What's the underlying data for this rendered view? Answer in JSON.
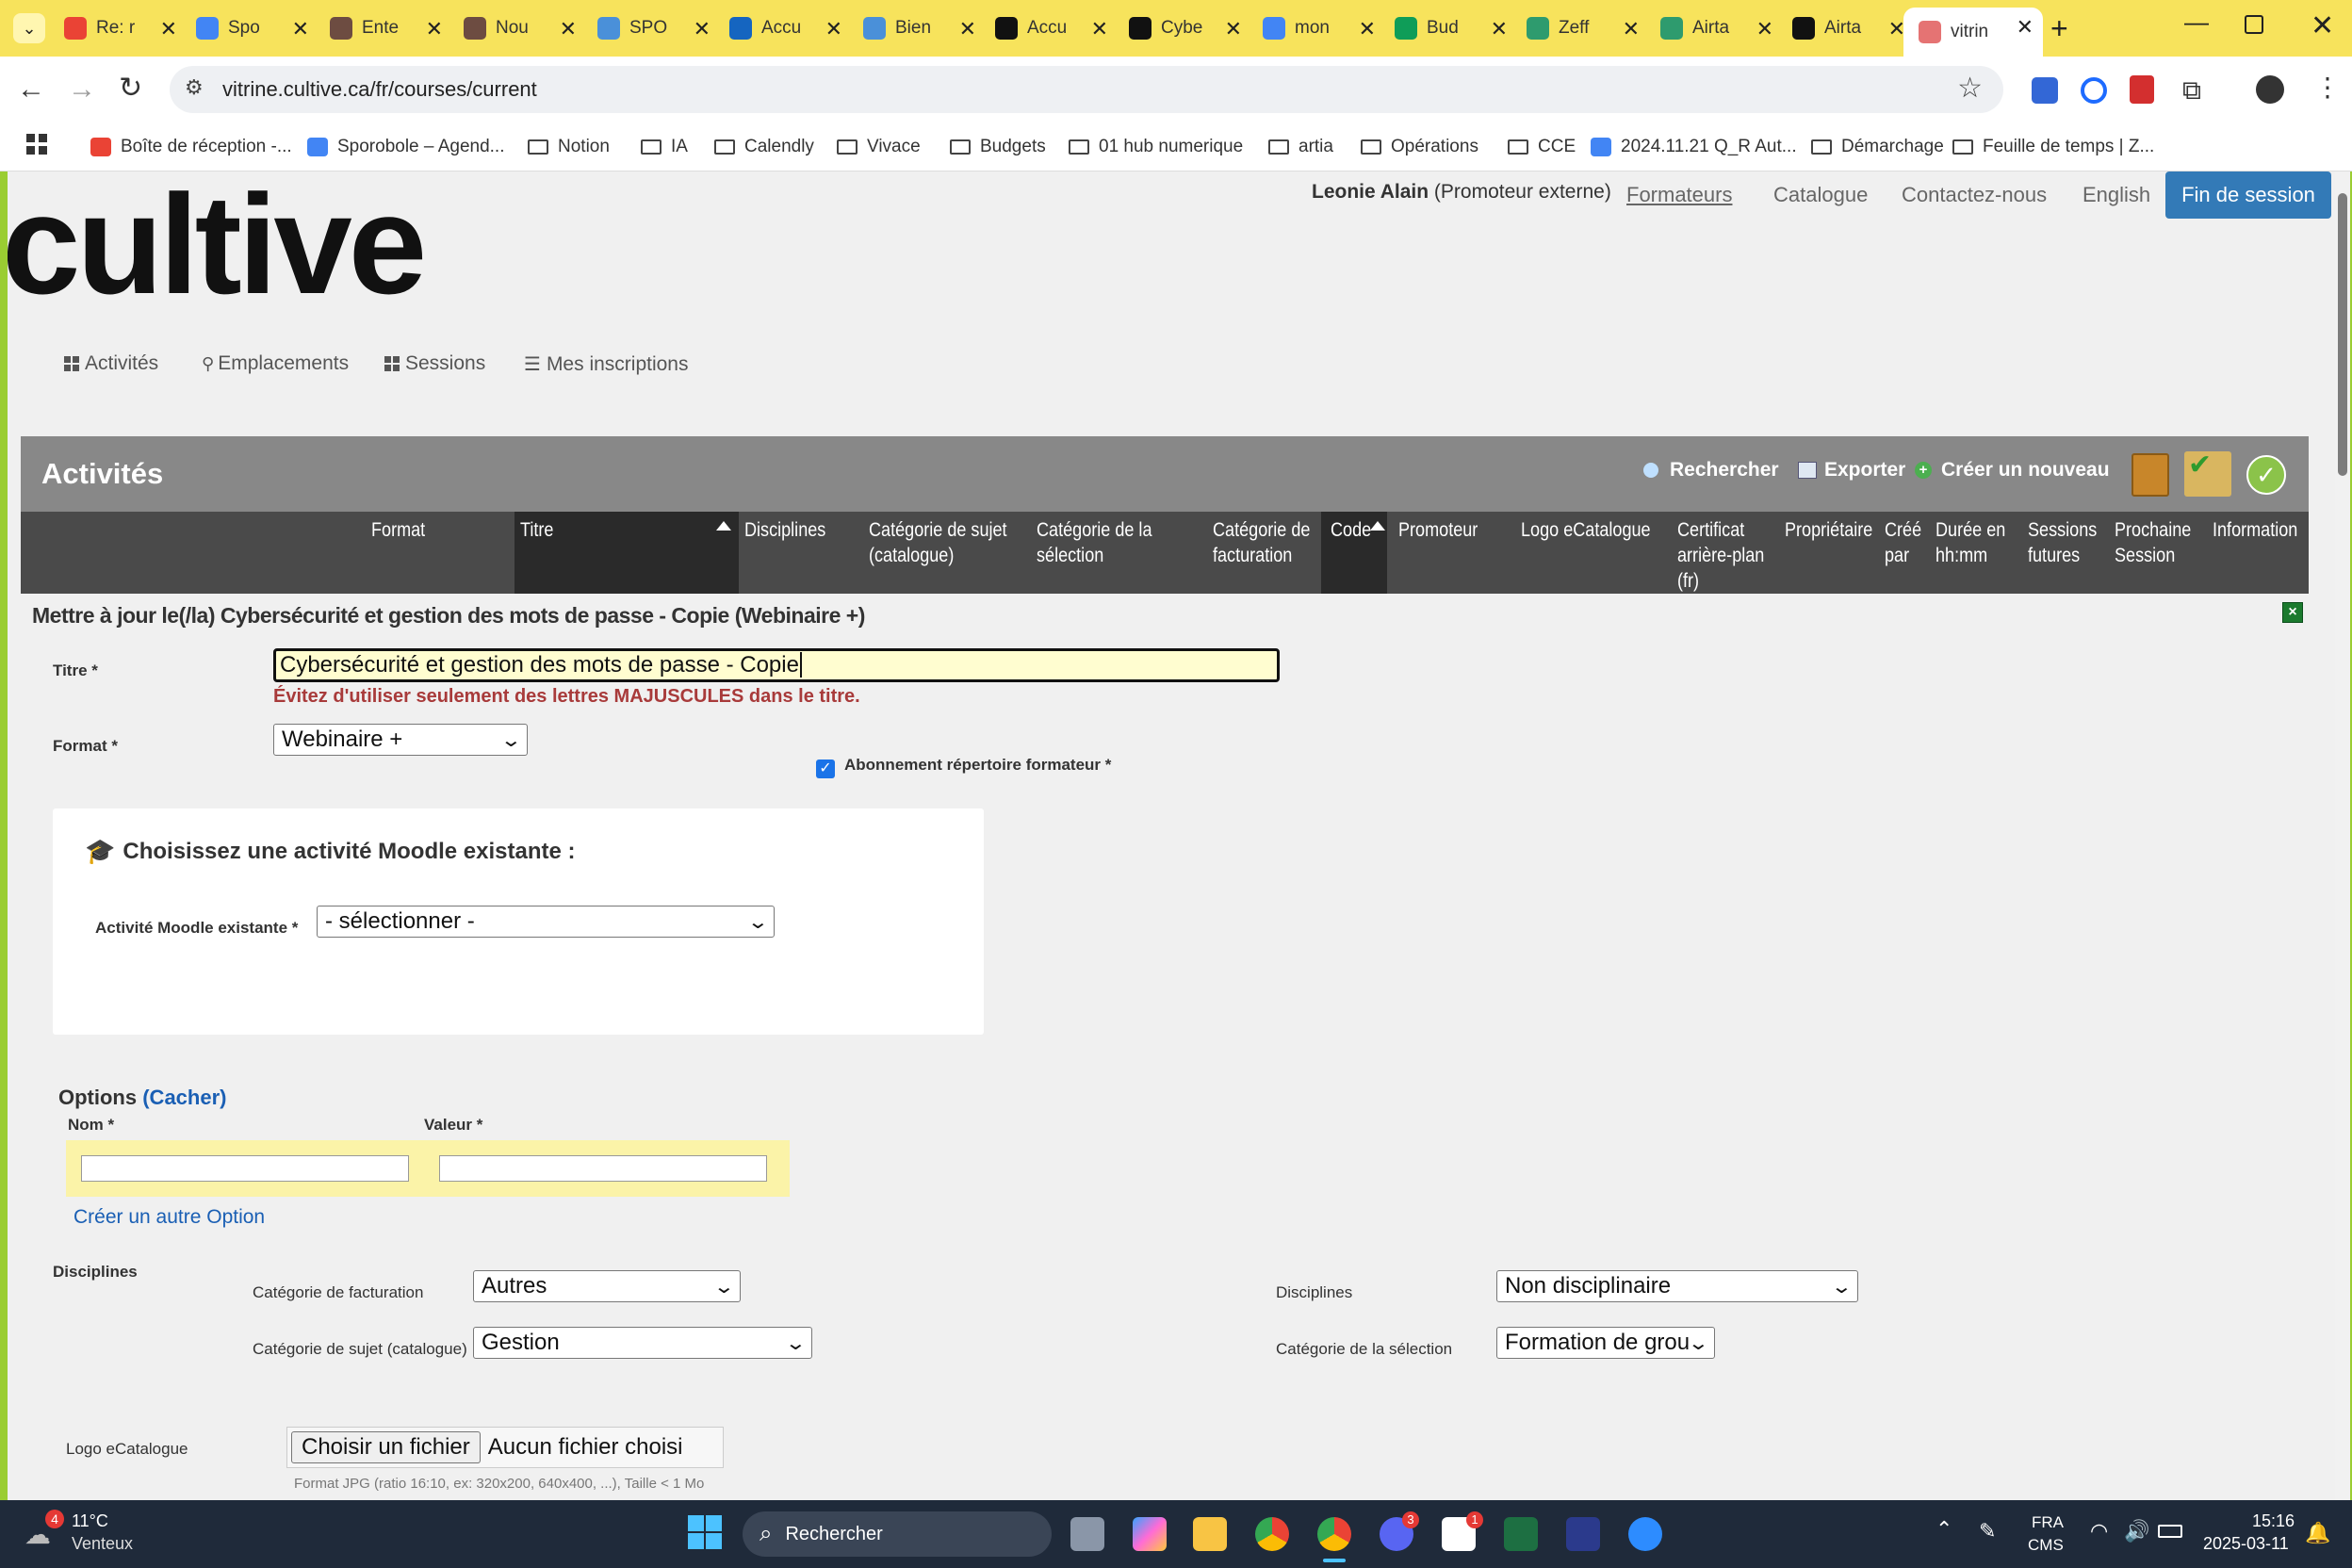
{
  "tabs": [
    {
      "label": "Re: r",
      "color": "#ea4335"
    },
    {
      "label": "Spo",
      "color": "#4285f4"
    },
    {
      "label": "Ente",
      "color": "#6d4c41"
    },
    {
      "label": "Nou",
      "color": "#6d4c41"
    },
    {
      "label": "SPO",
      "color": "#4a90d9"
    },
    {
      "label": "Accu",
      "color": "#1565c0"
    },
    {
      "label": "Bien",
      "color": "#4a90d9"
    },
    {
      "label": "Accu",
      "color": "#111111"
    },
    {
      "label": "Cybe",
      "color": "#111111"
    },
    {
      "label": "mon",
      "color": "#4285f4"
    },
    {
      "label": "Bud",
      "color": "#0f9d58"
    },
    {
      "label": "Zeff",
      "color": "#2e9b6e"
    },
    {
      "label": "Airta",
      "color": "#2e9b6e"
    },
    {
      "label": "Airta",
      "color": "#111111"
    },
    {
      "label": "vitrin",
      "color": "#e57373"
    }
  ],
  "url": "vitrine.cultive.ca/fr/courses/current",
  "bookmarks": [
    "Boîte de réception -...",
    "Sporobole – Agend...",
    "Notion",
    "IA",
    "Calendly",
    "Vivace",
    "Budgets",
    "01 hub numerique",
    "artia",
    "Opérations",
    "CCE",
    "2024.11.21 Q_R Aut...",
    "Démarchage",
    "Feuille de temps | Z..."
  ],
  "header": {
    "logo": "cultive",
    "user_name": "Leonie Alain",
    "user_role": "(Promoteur externe)",
    "links": [
      "Formateurs",
      "Catalogue",
      "Contactez-nous",
      "English"
    ],
    "logout": "Fin de session"
  },
  "nav": [
    "Activités",
    "Emplacements",
    "Sessions",
    "Mes inscriptions"
  ],
  "panel": {
    "title": "Activités",
    "search": "Rechercher",
    "export": "Exporter",
    "create": "Créer un nouveau"
  },
  "columns": [
    "Format",
    "Titre",
    "Disciplines",
    "Catégorie de sujet (catalogue)",
    "Catégorie de la sélection",
    "Catégorie de facturation",
    "Code",
    "Promoteur",
    "Logo eCatalogue",
    "Certificat arrière-plan (fr)",
    "Propriétaire",
    "Créé par",
    "Durée en hh:mm",
    "Sessions futures",
    "Prochaine Session",
    "Information"
  ],
  "form": {
    "heading": "Mettre à jour le(/la) Cybersécurité et gestion des mots de passe - Copie (Webinaire +)",
    "title_label": "Titre *",
    "title_value": "Cybersécurité et gestion des mots de passe - Copie",
    "title_warning": "Évitez d'utiliser seulement des lettres MAJUSCULES dans le titre.",
    "format_label": "Format *",
    "format_value": "Webinaire +",
    "subscription_label": "Abonnement répertoire formateur *",
    "moodle_heading": "Choisissez une activité Moodle existante :",
    "moodle_label": "Activité Moodle existante *",
    "moodle_value": "- sélectionner -",
    "options_label": "Options",
    "options_toggle": "(Cacher)",
    "option_name_label": "Nom *",
    "option_value_label": "Valeur *",
    "create_option": "Créer un autre Option",
    "disciplines_section": "Disciplines",
    "billing_label": "Catégorie de facturation",
    "billing_value": "Autres",
    "subject_label": "Catégorie de sujet (catalogue)",
    "subject_value": "Gestion",
    "disciplines_label": "Disciplines",
    "disciplines_value": "Non disciplinaire",
    "selection_label": "Catégorie de la sélection",
    "selection_value": "Formation de grou",
    "logo_label": "Logo eCatalogue",
    "file_button": "Choisir un fichier",
    "file_status": "Aucun fichier choisi",
    "file_hint": "Format JPG (ratio 16:10, ex: 320x200, 640x400, ...), Taille < 1 Mo"
  },
  "taskbar": {
    "temp": "11°C",
    "weather": "Venteux",
    "weather_badge": "4",
    "search": "Rechercher",
    "lang1": "FRA",
    "lang2": "CMS",
    "time": "15:16",
    "date": "2025-03-11",
    "discord_badge": "3",
    "notion_badge": "1"
  }
}
